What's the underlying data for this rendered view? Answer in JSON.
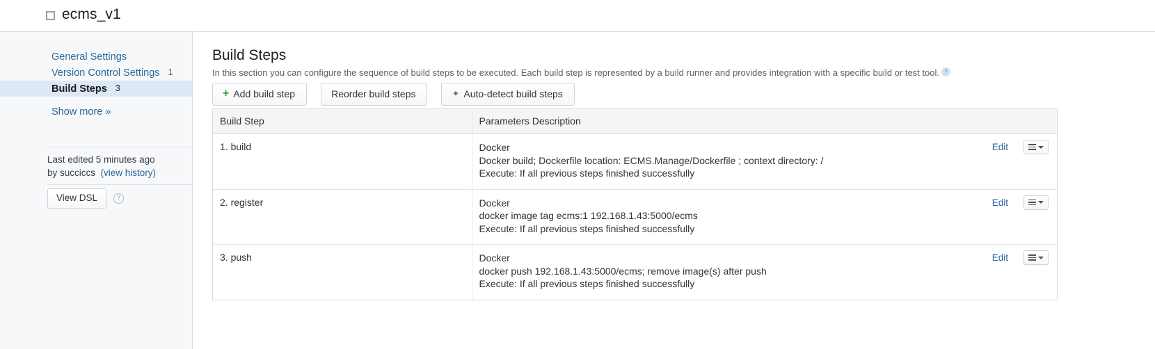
{
  "header": {
    "project_title": "ecms_v1",
    "project_icon": "square-outline-icon"
  },
  "sidebar": {
    "items": [
      {
        "label": "General Settings",
        "badge": "",
        "selected": false
      },
      {
        "label": "Version Control Settings",
        "badge": "1",
        "selected": false
      },
      {
        "label": "Build Steps",
        "badge": "3",
        "selected": true
      }
    ],
    "show_more_label": "Show more »",
    "last_edited": {
      "line1": "Last edited 5 minutes ago",
      "line2_prefix": "by succiccs",
      "history_link": "(view history)"
    },
    "view_dsl_label": "View DSL",
    "help_icon_glyph": "?"
  },
  "main": {
    "title": "Build Steps",
    "description": "In this section you can configure the sequence of build steps to be executed. Each build step is represented by a build runner and provides integration with a specific build or test tool.",
    "description_help_glyph": "?",
    "buttons": [
      {
        "label": "Add build step",
        "icon": "plus-icon"
      },
      {
        "label": "Reorder build steps",
        "icon": ""
      },
      {
        "label": "Auto-detect build steps",
        "icon": "wand-icon"
      }
    ],
    "table": {
      "columns": [
        "Build Step",
        "Parameters Description"
      ],
      "row_edit_label": "Edit",
      "rows": [
        {
          "step": "1. build",
          "params": [
            "Docker",
            "Docker build; Dockerfile location: ECMS.Manage/Dockerfile ; context directory: /",
            "Execute: If all previous steps finished successfully"
          ]
        },
        {
          "step": "2. register",
          "params": [
            "Docker",
            "docker image tag ecms:1 192.168.1.43:5000/ecms",
            "Execute: If all previous steps finished successfully"
          ]
        },
        {
          "step": "3. push",
          "params": [
            "Docker",
            "docker push 192.168.1.43:5000/ecms; remove image(s) after push",
            "Execute: If all previous steps finished successfully"
          ]
        }
      ]
    }
  },
  "colors": {
    "link": "#2a6496",
    "selected_nav_bg": "#dce8f5",
    "sidebar_bg": "#f6f8fa",
    "plus_green": "#3a9c4e",
    "table_header_bg": "#f4f5f6"
  }
}
